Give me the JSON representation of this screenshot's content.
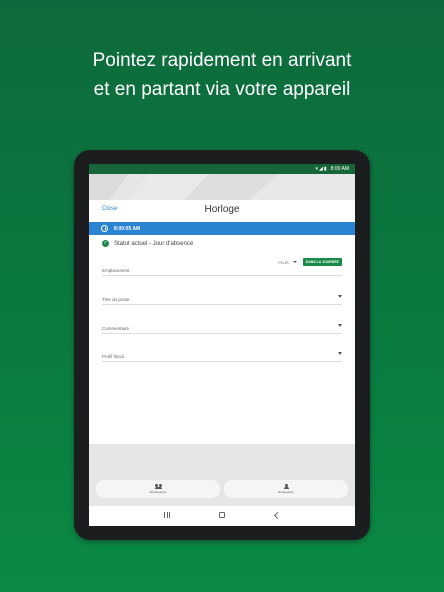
{
  "headline": {
    "line1": "Pointez rapidement en arrivant",
    "line2": "et en partant via votre appareil"
  },
  "statusbar": {
    "time": "8:00 AM",
    "icons": [
      "wifi-icon",
      "signal-icon",
      "battery-icon"
    ]
  },
  "card": {
    "close_label": "Close",
    "title": "Horloge",
    "time": "8:00:05 AM",
    "status_text": "Statut actuel - Jour d'absence",
    "plus_label": "PLUS",
    "day_button_label": "DANS LA JOURNÉE"
  },
  "fields": [
    {
      "label": "Emplacement"
    },
    {
      "label": "Titre du poste"
    },
    {
      "label": "Commentaire"
    },
    {
      "label": "Profil fiscal"
    }
  ],
  "bottom_buttons": [
    {
      "label": "Employé(e)s",
      "icon": "people-icon"
    },
    {
      "label": "Employé(e)",
      "icon": "person-icon"
    }
  ],
  "colors": {
    "background": "#0b7a40",
    "accent_blue": "#2a84d2",
    "accent_green": "#1a8a4a"
  }
}
